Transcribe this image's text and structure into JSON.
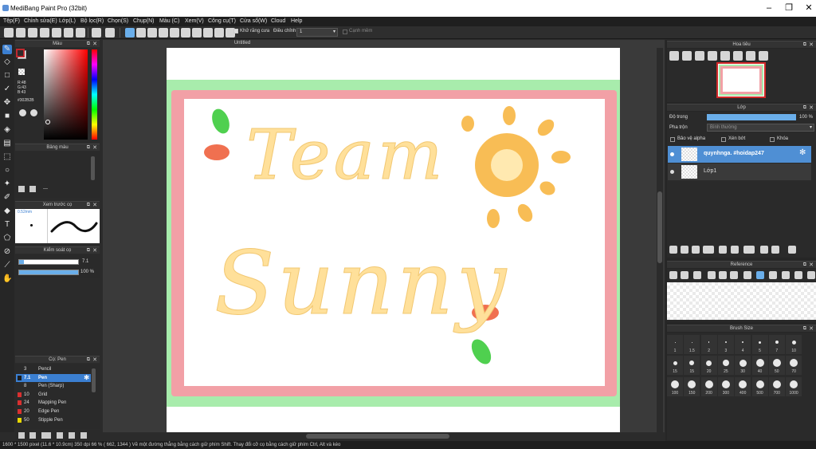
{
  "window": {
    "title": "MediBang Paint Pro (32bit)",
    "minimize_icon": "minimize-icon",
    "maximize_icon": "maximize-icon",
    "close_icon": "close-icon"
  },
  "menu": [
    "Tệp(F)",
    "Chỉnh sửa(E)",
    "Lớp(L)",
    "Bộ lọc(R)",
    "Chọn(S)",
    "Chụp(N)",
    "Màu (C)",
    "Xem(V)",
    "Công cụ(T)",
    "Cửa sổ(W)",
    "Cloud",
    "Help"
  ],
  "toolbar": {
    "antialias_label": "Khử răng cưa",
    "correction_label": "Điều chỉnh",
    "correction_value": "1",
    "smoothing_label": "Cạnh mềm"
  },
  "document": {
    "tab_title": "Untitled"
  },
  "color_panel": {
    "title": "Màu",
    "rgb_r": "R:48",
    "rgb_g": "G:43",
    "rgb_b": "B:43",
    "hex": "#302B2B",
    "main_color": "#302b2b"
  },
  "palette_panel": {
    "title": "Bảng màu",
    "dash": "---"
  },
  "brush_preview_panel": {
    "title": "Xem trước cọ",
    "size": "0.52mm"
  },
  "brush_control_panel": {
    "title": "Kiểm soát cọ",
    "size_value": "7.1",
    "opacity_value": "100 %"
  },
  "brush_list_panel": {
    "title": "Cọ: Pen",
    "items": [
      {
        "num": "3",
        "name": "Pencil",
        "color": "#2a2a2a"
      },
      {
        "num": "7.1",
        "name": "Pen",
        "color": "#1e1e1e",
        "selected": true
      },
      {
        "num": "8",
        "name": "Pen (Sharp)",
        "color": "#2a2a2a"
      },
      {
        "num": "10",
        "name": "Grid",
        "color": "#d93030"
      },
      {
        "num": "24",
        "name": "Mapping Pen",
        "color": "#d93030"
      },
      {
        "num": "20",
        "name": "Edge Pen",
        "color": "#d93030"
      },
      {
        "num": "50",
        "name": "Stipple Pen",
        "color": "#e8d800"
      }
    ]
  },
  "navigator_panel": {
    "title": "Hoa tiêu"
  },
  "layer_panel": {
    "title": "Lớp",
    "opacity_label": "Độ trong",
    "opacity_value": "100 %",
    "blend_label": "Pha trộn",
    "blend_value": "Bình thường",
    "protect_alpha": "Bảo vệ alpha",
    "clipping": "Xén bớt",
    "lock": "Khóa",
    "layers": [
      {
        "name": "quynhnga. #hoidap247",
        "selected": true
      },
      {
        "name": "Lớp1",
        "selected": false
      }
    ]
  },
  "reference_panel": {
    "title": "Reference"
  },
  "brush_size_panel": {
    "title": "Brush Size",
    "sizes_row1": [
      "1",
      "1.5",
      "2",
      "3",
      "4",
      "5",
      "7",
      "10"
    ],
    "sizes_row2": [
      "15",
      "15",
      "20",
      "25",
      "30",
      "40",
      "50",
      "70"
    ],
    "sizes_row3": [
      "100",
      "150",
      "200",
      "300",
      "400",
      "500",
      "700",
      "1000"
    ]
  },
  "artwork": {
    "line1": "Team",
    "line2": "Sunny",
    "frame_outer_color": "#a8ecac",
    "frame_inner_color": "#f2a0a6",
    "letter_color": "#ffe09a",
    "sun_color": "#f8bd55"
  },
  "status_bar": {
    "text": "1600 * 1500 pixel  (11.6 * 10.9cm)  350 dpi  66 %  ( 662, 1344 )  Vẽ một đường thẳng bằng cách giữ phím Shift. Thay đổi cỡ cọ bằng cách giữ phím Ctrl, Alt và kéo"
  }
}
